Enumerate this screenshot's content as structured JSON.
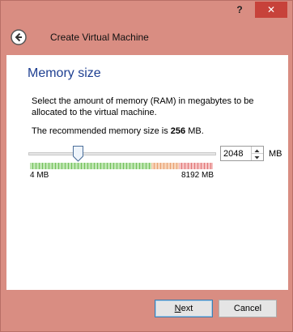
{
  "window": {
    "help_label": "?",
    "close_label": "✕"
  },
  "header": {
    "back_icon": "back-arrow-icon",
    "title": "Create Virtual Machine"
  },
  "page": {
    "heading": "Memory size",
    "description": "Select the amount of memory (RAM) in megabytes to be allocated to the virtual machine.",
    "recommend_prefix": "The recommended memory size is ",
    "recommend_value": "256",
    "recommend_suffix": " MB."
  },
  "memory": {
    "value": "2048",
    "unit": "MB",
    "min_label": "4 MB",
    "max_label": "8192 MB",
    "slider_fraction": 0.25
  },
  "buttons": {
    "next_mnemonic": "N",
    "next_rest": "ext",
    "cancel": "Cancel"
  },
  "colors": {
    "accent": "#1e3f91",
    "window_frame": "#d98d82",
    "close": "#c7423a"
  }
}
